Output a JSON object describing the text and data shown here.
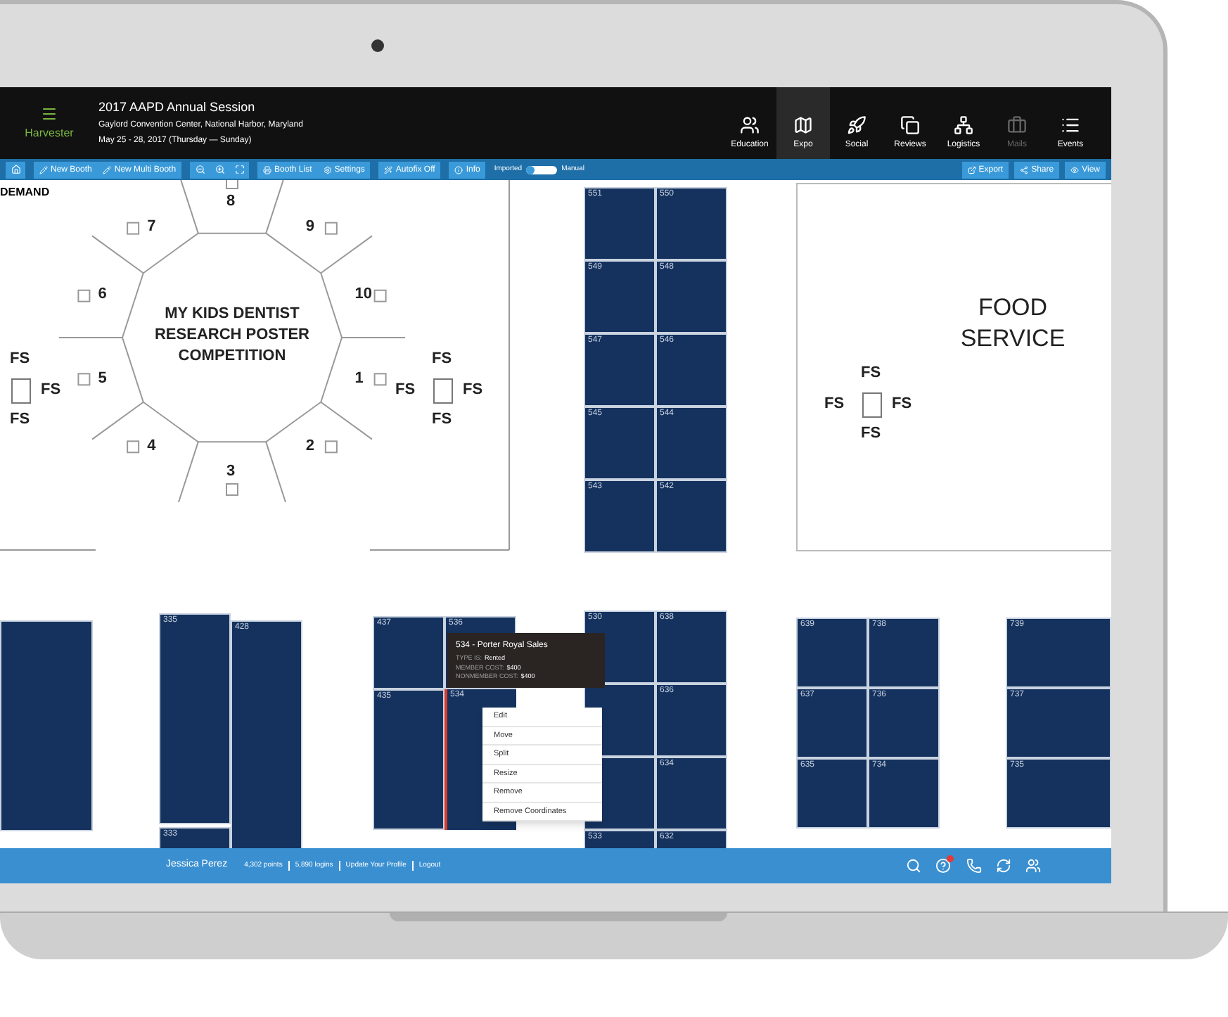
{
  "header": {
    "app_name": "Harvester",
    "title": "2017 AAPD Annual Session",
    "venue": "Gaylord Convention Center, National Harbor, Maryland",
    "dates": "May 25 - 28, 2017 (Thursday — Sunday)"
  },
  "nav": [
    {
      "label": "Education",
      "selected": false,
      "disabled": false
    },
    {
      "label": "Expo",
      "selected": true,
      "disabled": false
    },
    {
      "label": "Social",
      "selected": false,
      "disabled": false
    },
    {
      "label": "Reviews",
      "selected": false,
      "disabled": false
    },
    {
      "label": "Logistics",
      "selected": false,
      "disabled": false
    },
    {
      "label": "Mails",
      "selected": false,
      "disabled": true
    },
    {
      "label": "Events",
      "selected": false,
      "disabled": false
    }
  ],
  "toolbar": {
    "buttons": [
      "New Booth",
      "New Multi Booth",
      "Booth List",
      "Settings",
      "Autofix Off",
      "Info"
    ],
    "toggle": {
      "left_label": "Imported",
      "right_label": "Manual",
      "on": false
    },
    "right_buttons": [
      "Export",
      "Share",
      "View"
    ]
  },
  "map": {
    "room_label": "DEMAND",
    "poster_title": "MY KIDS DENTIST RESEARCH POSTER COMPETITION",
    "posters": [
      "1",
      "2",
      "3",
      "4",
      "5",
      "6",
      "7",
      "8",
      "9",
      "10"
    ],
    "food_service": "FOOD SERVICE",
    "fs_groups": [
      {
        "top": "FS",
        "right": "FS",
        "bottom": "FS"
      },
      {
        "top": "FS",
        "left": "FS",
        "right": "FS",
        "bottom": "FS"
      },
      {
        "top": "FS",
        "left": "FS",
        "right": "FS",
        "bottom": "FS"
      }
    ],
    "booths": [
      {
        "number": "551",
        "selected": false
      },
      {
        "number": "549",
        "selected": false
      },
      {
        "number": "547",
        "selected": false
      },
      {
        "number": "545",
        "selected": false
      },
      {
        "number": "543",
        "selected": false
      },
      {
        "number": "550",
        "selected": false
      },
      {
        "number": "548",
        "selected": false
      },
      {
        "number": "546",
        "selected": false
      },
      {
        "number": "544",
        "selected": false
      },
      {
        "number": "542",
        "selected": false
      },
      {
        "selected": false
      },
      {
        "number": "335",
        "selected": false
      },
      {
        "number": "333",
        "selected": false
      },
      {
        "number": "428",
        "selected": false
      },
      {
        "number": "437",
        "selected": false
      },
      {
        "number": "435",
        "selected": false
      },
      {
        "number": "536",
        "selected": false
      },
      {
        "number": "534",
        "selected": true
      },
      {
        "number": "530",
        "selected": false
      },
      {
        "selected": false
      },
      {
        "selected": false
      },
      {
        "number": "533",
        "selected": false
      },
      {
        "number": "638",
        "selected": false
      },
      {
        "number": "636",
        "selected": false
      },
      {
        "number": "634",
        "selected": false
      },
      {
        "number": "632",
        "selected": false
      },
      {
        "number": "639",
        "selected": false
      },
      {
        "number": "637",
        "selected": false
      },
      {
        "number": "635",
        "selected": false
      },
      {
        "number": "738",
        "selected": false
      },
      {
        "number": "736",
        "selected": false
      },
      {
        "number": "734",
        "selected": false
      },
      {
        "number": "739",
        "selected": false
      },
      {
        "number": "737",
        "selected": false
      },
      {
        "number": "735",
        "selected": false
      }
    ]
  },
  "tooltip": {
    "title": "534 - Porter Royal Sales",
    "lines": [
      {
        "label": "TYPE IS:",
        "value": "Rented"
      },
      {
        "label": "MEMBER COST:",
        "value": "$400"
      },
      {
        "label": "NONMEMBER COST:",
        "value": "$400"
      }
    ]
  },
  "context_menu": [
    "Edit",
    "Move",
    "Split",
    "Resize",
    "Remove",
    "Remove Coordinates"
  ],
  "status_bar": {
    "user": "Jessica Perez",
    "links": [
      "4,302 points",
      "5,890 logins",
      "Update Your Profile",
      "Logout"
    ]
  }
}
